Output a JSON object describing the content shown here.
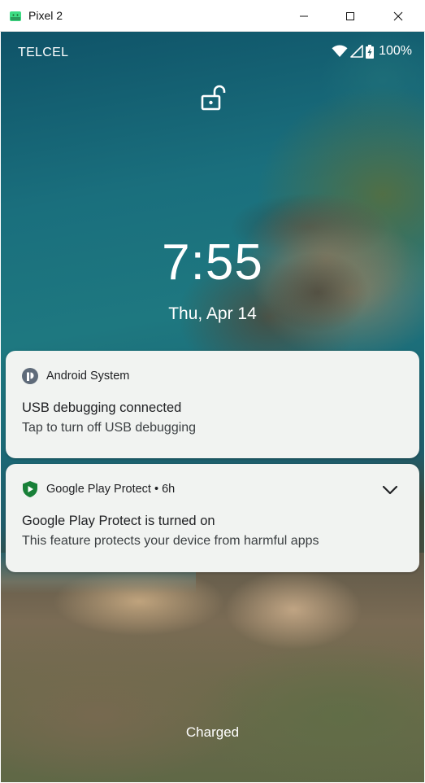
{
  "window": {
    "title": "Pixel 2",
    "icon": "android-emulator-icon",
    "controls": [
      "minimize",
      "maximize",
      "close"
    ]
  },
  "status_bar": {
    "carrier": "TELCEL",
    "battery": "100%",
    "icons": [
      "wifi-icon",
      "cell-signal-icon",
      "battery-charging-icon"
    ]
  },
  "lock_screen": {
    "lock_icon": "unlocked-padlock-icon",
    "time": "7:55",
    "date": "Thu, Apr 14",
    "charging_status": "Charged"
  },
  "notifications": [
    {
      "app": "Android System",
      "title": "USB debugging connected",
      "text": "Tap to turn off USB debugging",
      "icon": "android-system-icon"
    },
    {
      "app": "Google Play Protect",
      "time": "6h",
      "app_line": "Google Play Protect • 6h",
      "title": "Google Play Protect is turned on",
      "text": "This feature protects your device from harmful apps",
      "icon": "play-protect-shield-icon",
      "accent_color": "#188038"
    }
  ],
  "colors": {
    "notification_bg": "#f1f3f1",
    "text_primary": "#202124"
  }
}
